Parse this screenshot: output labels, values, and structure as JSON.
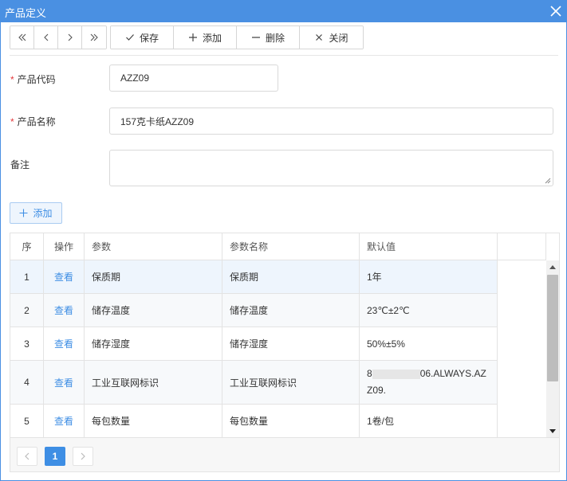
{
  "window": {
    "title": "产品定义"
  },
  "toolbar": {
    "nav": [
      {
        "name": "first-page-button",
        "icon": "double-chevron-left-icon"
      },
      {
        "name": "prev-page-button",
        "icon": "chevron-left-icon"
      },
      {
        "name": "next-page-button",
        "icon": "chevron-right-icon"
      },
      {
        "name": "last-page-button",
        "icon": "double-chevron-right-icon"
      }
    ],
    "save_label": "保存",
    "add_label": "添加",
    "delete_label": "删除",
    "close_label": "关闭"
  },
  "form": {
    "code_label": "产品代码",
    "code_value": "AZZ09",
    "name_label": "产品名称",
    "name_value": "157克卡纸AZZ09",
    "remark_label": "备注",
    "remark_value": "",
    "required_mark": "*"
  },
  "add_button_label": "添加",
  "table": {
    "headers": [
      "序",
      "操作",
      "参数",
      "参数名称",
      "默认值"
    ],
    "rows": [
      {
        "seq": "1",
        "action": "查看",
        "param": "保质期",
        "param_name": "保质期",
        "default": "1年"
      },
      {
        "seq": "2",
        "action": "查看",
        "param": "储存温度",
        "param_name": "储存温度",
        "default": "23℃±2℃"
      },
      {
        "seq": "3",
        "action": "查看",
        "param": "储存湿度",
        "param_name": "储存湿度",
        "default": "50%±5%"
      },
      {
        "seq": "4",
        "action": "查看",
        "param": "工业互联网标识",
        "param_name": "工业互联网标识",
        "default_prefix": "8",
        "default_suffix": "06.ALWAYS.AZZ09."
      },
      {
        "seq": "5",
        "action": "查看",
        "param": "每包数量",
        "param_name": "每包数量",
        "default": "1卷/包"
      }
    ]
  },
  "pager": {
    "current_page": "1"
  },
  "colors": {
    "accent": "#4a90e2",
    "link": "#3e8ee4",
    "required": "#e4393c"
  }
}
